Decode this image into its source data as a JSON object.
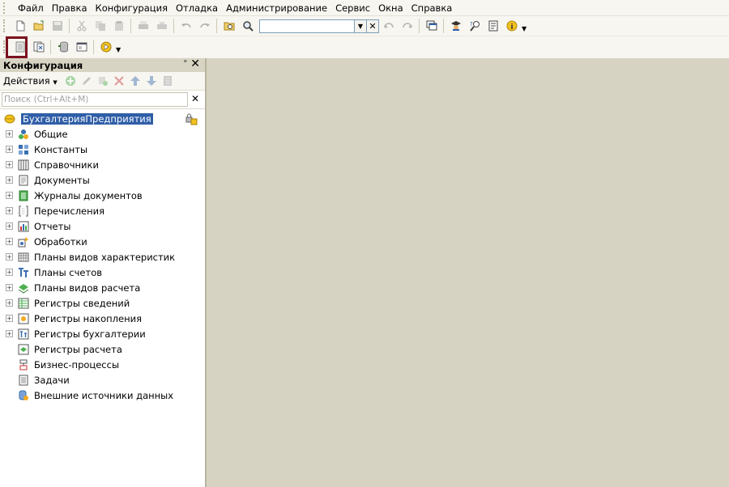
{
  "menu": [
    {
      "label": "Файл"
    },
    {
      "label": "Правка"
    },
    {
      "label": "Конфигурация"
    },
    {
      "label": "Отладка"
    },
    {
      "label": "Администрирование"
    },
    {
      "label": "Сервис"
    },
    {
      "label": "Окна"
    },
    {
      "label": "Справка"
    }
  ],
  "panel": {
    "title": "Конфигурация",
    "actions_label": "Действия",
    "search_placeholder": "Поиск (Ctrl+Alt+M)",
    "root": "БухгалтерияПредприятия",
    "items": [
      {
        "label": "Общие",
        "expandable": true,
        "icon": "common-icon"
      },
      {
        "label": "Константы",
        "expandable": true,
        "icon": "constants-icon"
      },
      {
        "label": "Справочники",
        "expandable": true,
        "icon": "catalogs-icon"
      },
      {
        "label": "Документы",
        "expandable": true,
        "icon": "documents-icon"
      },
      {
        "label": "Журналы документов",
        "expandable": true,
        "icon": "journals-icon"
      },
      {
        "label": "Перечисления",
        "expandable": true,
        "icon": "enums-icon"
      },
      {
        "label": "Отчеты",
        "expandable": true,
        "icon": "reports-icon"
      },
      {
        "label": "Обработки",
        "expandable": true,
        "icon": "processing-icon"
      },
      {
        "label": "Планы видов характеристик",
        "expandable": true,
        "icon": "char-types-icon"
      },
      {
        "label": "Планы счетов",
        "expandable": true,
        "icon": "chart-of-accounts-icon"
      },
      {
        "label": "Планы видов расчета",
        "expandable": true,
        "icon": "calc-types-icon"
      },
      {
        "label": "Регистры сведений",
        "expandable": true,
        "icon": "info-registers-icon"
      },
      {
        "label": "Регистры накопления",
        "expandable": true,
        "icon": "accum-registers-icon"
      },
      {
        "label": "Регистры бухгалтерии",
        "expandable": true,
        "icon": "accounting-registers-icon"
      },
      {
        "label": "Регистры расчета",
        "expandable": false,
        "icon": "calc-registers-icon"
      },
      {
        "label": "Бизнес-процессы",
        "expandable": false,
        "icon": "business-processes-icon"
      },
      {
        "label": "Задачи",
        "expandable": false,
        "icon": "tasks-icon"
      },
      {
        "label": "Внешние источники данных",
        "expandable": false,
        "icon": "external-sources-icon"
      }
    ]
  },
  "colors": {
    "highlight": "#7b1220",
    "selection": "#2f5ea7",
    "workspace": "#d6d3c3"
  }
}
